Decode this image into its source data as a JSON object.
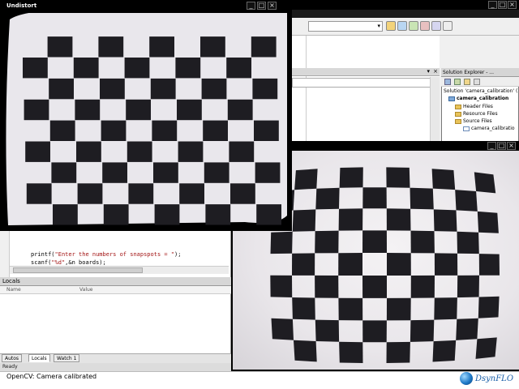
{
  "undistort_window": {
    "title": "Undistort"
  },
  "solution_explorer": {
    "title": "Solution Explorer - ...",
    "items": [
      "Solution 'camera_calibration' (",
      "camera_calibration",
      "Header Files",
      "Resource Files",
      "Source Files",
      "camera_calibratio"
    ]
  },
  "code": {
    "line1_prefix": "printf(",
    "line1_string": "\"Enter the numbers of snapspots = \"",
    "line1_suffix": ");",
    "line2_prefix": "scanf(",
    "line2_string": "\"%d\"",
    "line2_suffix": ",&n boards);"
  },
  "locals_pane": {
    "title": "Locals",
    "col_name": "Name",
    "col_value": "Value",
    "tabs": [
      "Autos",
      "Locals",
      "Watch 1"
    ],
    "active_tab": "Locals",
    "ready": "Ready"
  },
  "status_bar": {
    "message": "OpenCV: Camera calibrated"
  },
  "logo": {
    "text": "DsynFLO",
    "color": "#1a5fa8"
  },
  "colors": {
    "checker_dark": "#1e1d22",
    "checker_light": "#f1eff3",
    "titlebar": "#000000"
  }
}
